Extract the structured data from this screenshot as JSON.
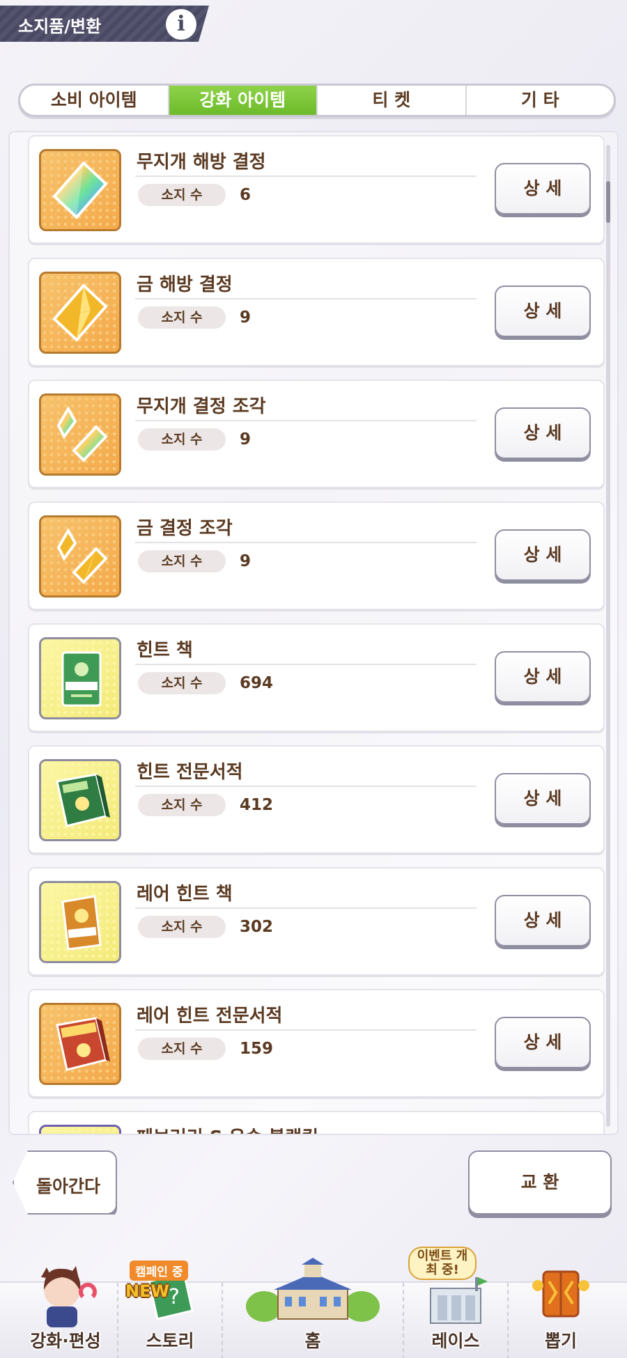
{
  "header": {
    "title": "소지품/변환",
    "info_icon": "i"
  },
  "tabs": [
    {
      "label": "소비 아이템",
      "active": false
    },
    {
      "label": "강화 아이템",
      "active": true
    },
    {
      "label": "티 켓",
      "active": false
    },
    {
      "label": "기 타",
      "active": false
    }
  ],
  "qty_label": "소지 수",
  "detail_label": "상 세",
  "items": [
    {
      "name": "무지개 해방 결정",
      "qty": "6",
      "icon": "rainbow-crystal-icon"
    },
    {
      "name": "금 해방 결정",
      "qty": "9",
      "icon": "gold-crystal-icon"
    },
    {
      "name": "무지개 결정 조각",
      "qty": "9",
      "icon": "rainbow-shard-icon"
    },
    {
      "name": "금 결정 조각",
      "qty": "9",
      "icon": "gold-shard-icon"
    },
    {
      "name": "힌트 책",
      "qty": "694",
      "icon": "hint-book-icon"
    },
    {
      "name": "힌트 전문서적",
      "qty": "412",
      "icon": "hint-pro-book-icon"
    },
    {
      "name": "레어 힌트 책",
      "qty": "302",
      "icon": "rare-hint-book-icon"
    },
    {
      "name": "레어 힌트 전문서적",
      "qty": "159",
      "icon": "rare-hint-pro-book-icon"
    },
    {
      "name": "페브러리 S 우승 블랭킷",
      "qty": "",
      "icon": "blanket-icon"
    }
  ],
  "footer": {
    "back_label": "돌아간다",
    "exchange_label": "교 환"
  },
  "nav": [
    {
      "label": "강화·편성",
      "icon": "character-icon"
    },
    {
      "label": "스토리",
      "icon": "story-book-icon",
      "badge_campaign": "캠페인 중",
      "badge_new": "NEW"
    },
    {
      "label": "홈",
      "icon": "school-building-icon"
    },
    {
      "label": "레이스",
      "icon": "race-gate-icon",
      "badge_event": "이벤트 개최 중!"
    },
    {
      "label": "뽑기",
      "icon": "gacha-door-icon"
    }
  ],
  "colors": {
    "accent_green": "#6cbb2a",
    "text_brown": "#5b3a22",
    "header_bg": "#4a4963"
  }
}
